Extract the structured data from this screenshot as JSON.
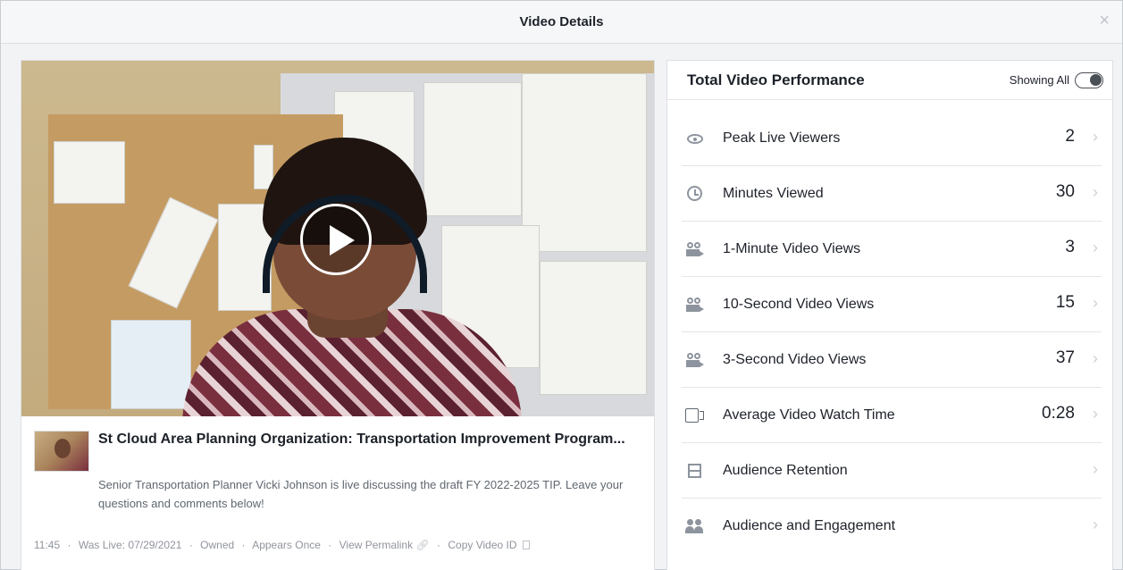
{
  "modal": {
    "title": "Video Details",
    "close_label": "×"
  },
  "post": {
    "title": "St Cloud Area Planning Organization: Transportation Improvement Program...",
    "description": "Senior Transportation Planner Vicki Johnson is live discussing the draft FY 2022-2025 TIP. Leave your questions and comments below!",
    "duration": "11:45",
    "was_live": "Was Live: 07/29/2021",
    "ownership": "Owned",
    "appears": "Appears Once",
    "view_permalink": "View Permalink",
    "copy_video_id": "Copy Video ID",
    "separator": "·"
  },
  "performance": {
    "title": "Total Video Performance",
    "showing_label": "Showing All",
    "chevron": "›",
    "metrics": [
      {
        "icon": "eye-icon",
        "label": "Peak Live Viewers",
        "value": "2"
      },
      {
        "icon": "clock-icon",
        "label": "Minutes Viewed",
        "value": "30"
      },
      {
        "icon": "video-camera-icon",
        "label": "1-Minute Video Views",
        "value": "3"
      },
      {
        "icon": "video-camera-icon",
        "label": "10-Second Video Views",
        "value": "15"
      },
      {
        "icon": "video-camera-icon",
        "label": "3-Second Video Views",
        "value": "37"
      },
      {
        "icon": "video-icon",
        "label": "Average Video Watch Time",
        "value": "0:28"
      },
      {
        "icon": "film-icon",
        "label": "Audience Retention",
        "value": ""
      },
      {
        "icon": "people-icon",
        "label": "Audience and Engagement",
        "value": ""
      }
    ]
  }
}
